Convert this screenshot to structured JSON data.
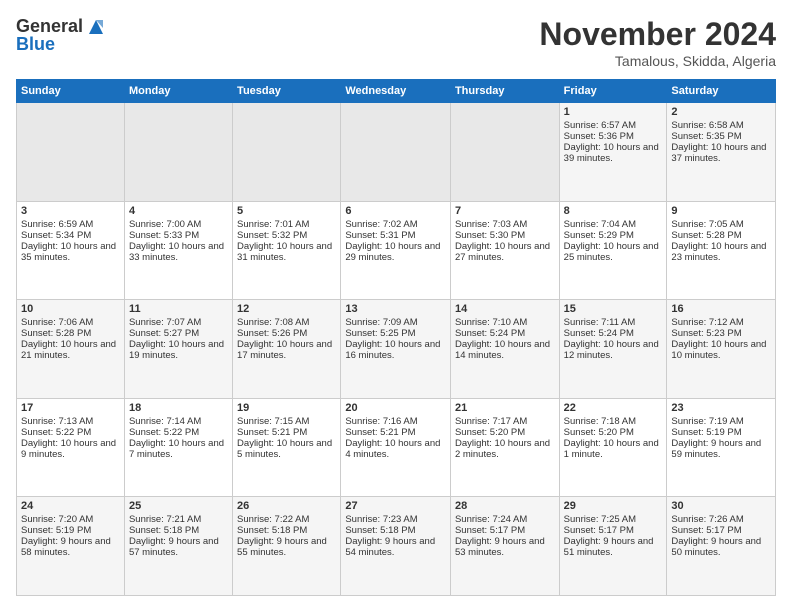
{
  "logo": {
    "line1": "General",
    "line2": "Blue"
  },
  "title": "November 2024",
  "location": "Tamalous, Skidda, Algeria",
  "headers": [
    "Sunday",
    "Monday",
    "Tuesday",
    "Wednesday",
    "Thursday",
    "Friday",
    "Saturday"
  ],
  "weeks": [
    [
      {
        "day": "",
        "info": ""
      },
      {
        "day": "",
        "info": ""
      },
      {
        "day": "",
        "info": ""
      },
      {
        "day": "",
        "info": ""
      },
      {
        "day": "",
        "info": ""
      },
      {
        "day": "1",
        "info": "Sunrise: 6:57 AM\nSunset: 5:36 PM\nDaylight: 10 hours and 39 minutes."
      },
      {
        "day": "2",
        "info": "Sunrise: 6:58 AM\nSunset: 5:35 PM\nDaylight: 10 hours and 37 minutes."
      }
    ],
    [
      {
        "day": "3",
        "info": "Sunrise: 6:59 AM\nSunset: 5:34 PM\nDaylight: 10 hours and 35 minutes."
      },
      {
        "day": "4",
        "info": "Sunrise: 7:00 AM\nSunset: 5:33 PM\nDaylight: 10 hours and 33 minutes."
      },
      {
        "day": "5",
        "info": "Sunrise: 7:01 AM\nSunset: 5:32 PM\nDaylight: 10 hours and 31 minutes."
      },
      {
        "day": "6",
        "info": "Sunrise: 7:02 AM\nSunset: 5:31 PM\nDaylight: 10 hours and 29 minutes."
      },
      {
        "day": "7",
        "info": "Sunrise: 7:03 AM\nSunset: 5:30 PM\nDaylight: 10 hours and 27 minutes."
      },
      {
        "day": "8",
        "info": "Sunrise: 7:04 AM\nSunset: 5:29 PM\nDaylight: 10 hours and 25 minutes."
      },
      {
        "day": "9",
        "info": "Sunrise: 7:05 AM\nSunset: 5:28 PM\nDaylight: 10 hours and 23 minutes."
      }
    ],
    [
      {
        "day": "10",
        "info": "Sunrise: 7:06 AM\nSunset: 5:28 PM\nDaylight: 10 hours and 21 minutes."
      },
      {
        "day": "11",
        "info": "Sunrise: 7:07 AM\nSunset: 5:27 PM\nDaylight: 10 hours and 19 minutes."
      },
      {
        "day": "12",
        "info": "Sunrise: 7:08 AM\nSunset: 5:26 PM\nDaylight: 10 hours and 17 minutes."
      },
      {
        "day": "13",
        "info": "Sunrise: 7:09 AM\nSunset: 5:25 PM\nDaylight: 10 hours and 16 minutes."
      },
      {
        "day": "14",
        "info": "Sunrise: 7:10 AM\nSunset: 5:24 PM\nDaylight: 10 hours and 14 minutes."
      },
      {
        "day": "15",
        "info": "Sunrise: 7:11 AM\nSunset: 5:24 PM\nDaylight: 10 hours and 12 minutes."
      },
      {
        "day": "16",
        "info": "Sunrise: 7:12 AM\nSunset: 5:23 PM\nDaylight: 10 hours and 10 minutes."
      }
    ],
    [
      {
        "day": "17",
        "info": "Sunrise: 7:13 AM\nSunset: 5:22 PM\nDaylight: 10 hours and 9 minutes."
      },
      {
        "day": "18",
        "info": "Sunrise: 7:14 AM\nSunset: 5:22 PM\nDaylight: 10 hours and 7 minutes."
      },
      {
        "day": "19",
        "info": "Sunrise: 7:15 AM\nSunset: 5:21 PM\nDaylight: 10 hours and 5 minutes."
      },
      {
        "day": "20",
        "info": "Sunrise: 7:16 AM\nSunset: 5:21 PM\nDaylight: 10 hours and 4 minutes."
      },
      {
        "day": "21",
        "info": "Sunrise: 7:17 AM\nSunset: 5:20 PM\nDaylight: 10 hours and 2 minutes."
      },
      {
        "day": "22",
        "info": "Sunrise: 7:18 AM\nSunset: 5:20 PM\nDaylight: 10 hours and 1 minute."
      },
      {
        "day": "23",
        "info": "Sunrise: 7:19 AM\nSunset: 5:19 PM\nDaylight: 9 hours and 59 minutes."
      }
    ],
    [
      {
        "day": "24",
        "info": "Sunrise: 7:20 AM\nSunset: 5:19 PM\nDaylight: 9 hours and 58 minutes."
      },
      {
        "day": "25",
        "info": "Sunrise: 7:21 AM\nSunset: 5:18 PM\nDaylight: 9 hours and 57 minutes."
      },
      {
        "day": "26",
        "info": "Sunrise: 7:22 AM\nSunset: 5:18 PM\nDaylight: 9 hours and 55 minutes."
      },
      {
        "day": "27",
        "info": "Sunrise: 7:23 AM\nSunset: 5:18 PM\nDaylight: 9 hours and 54 minutes."
      },
      {
        "day": "28",
        "info": "Sunrise: 7:24 AM\nSunset: 5:17 PM\nDaylight: 9 hours and 53 minutes."
      },
      {
        "day": "29",
        "info": "Sunrise: 7:25 AM\nSunset: 5:17 PM\nDaylight: 9 hours and 51 minutes."
      },
      {
        "day": "30",
        "info": "Sunrise: 7:26 AM\nSunset: 5:17 PM\nDaylight: 9 hours and 50 minutes."
      }
    ]
  ]
}
